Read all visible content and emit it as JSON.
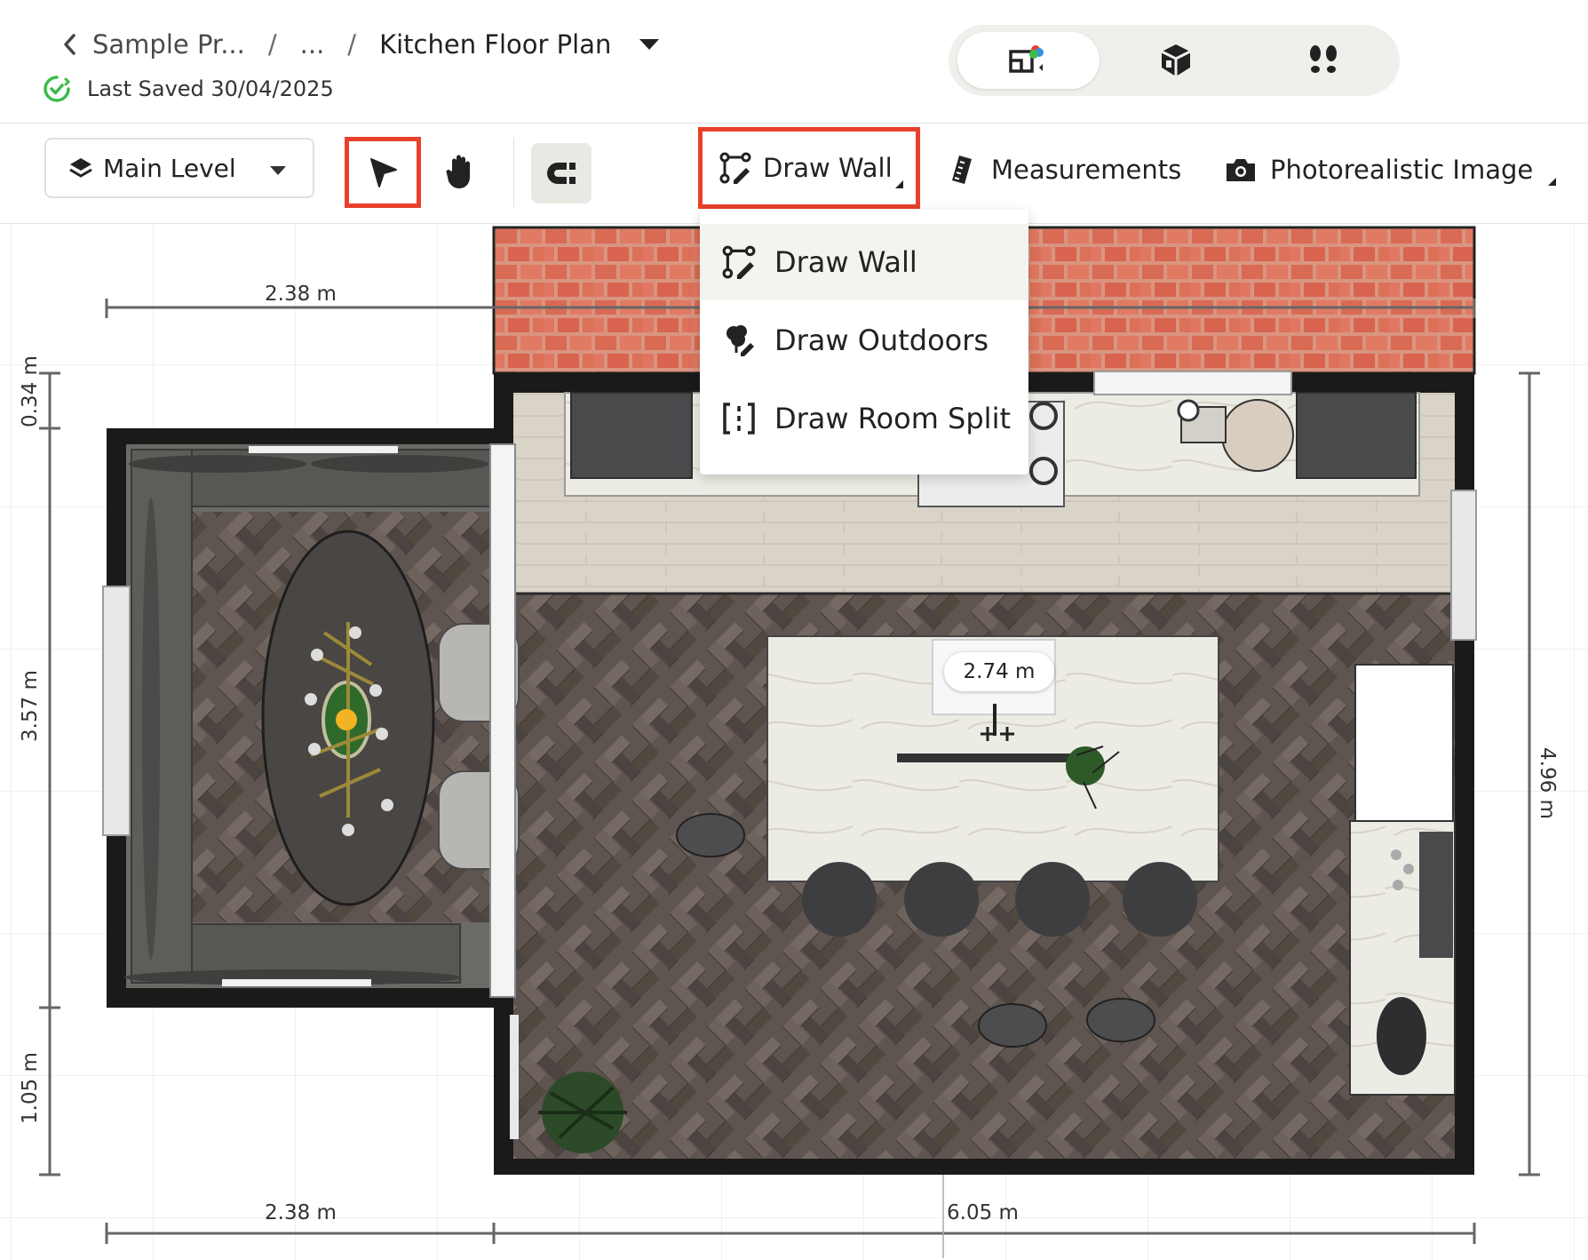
{
  "header": {
    "breadcrumb": {
      "root": "Sample Pr...",
      "middle": "...",
      "current": "Kitchen Floor Plan"
    },
    "saved_text": "Last Saved 30/04/2025",
    "view_modes": [
      "2d-plan-icon",
      "3d-box-icon",
      "walkthrough-footprints-icon"
    ]
  },
  "toolbar": {
    "level_label": "Main Level",
    "draw_wall_label": "Draw Wall",
    "measurements_label": "Measurements",
    "photo_label": "Photorealistic Image"
  },
  "draw_menu": {
    "items": [
      {
        "label": "Draw Wall",
        "icon": "draw-wall-icon"
      },
      {
        "label": "Draw Outdoors",
        "icon": "draw-outdoors-icon"
      },
      {
        "label": "Draw Room Split",
        "icon": "room-split-icon"
      }
    ]
  },
  "plan": {
    "dims": {
      "top_left": "2.38 m",
      "left_top": "0.34 m",
      "left_mid": "3.57 m",
      "left_bot": "1.05 m",
      "right": "4.96 m",
      "bottom_left": "2.38 m",
      "bottom_right": "6.05 m",
      "island": "2.74 m"
    }
  },
  "colors": {
    "accent_red": "#e8402c",
    "wall": "#1a1a1a",
    "saved_green": "#3dbb4a"
  }
}
